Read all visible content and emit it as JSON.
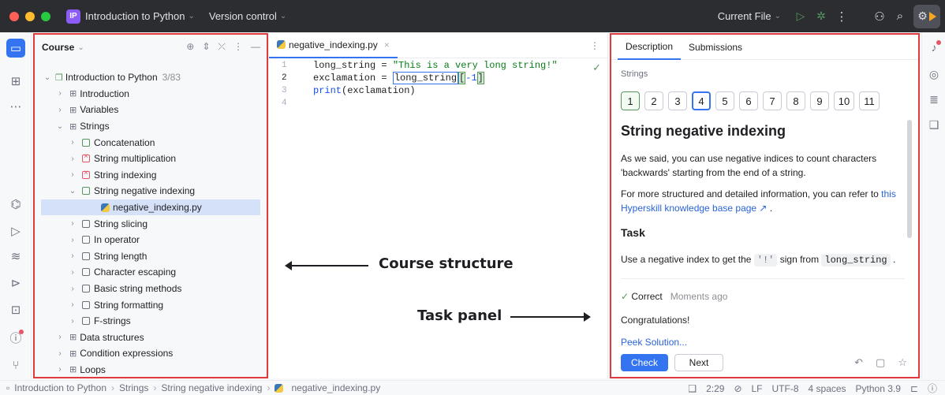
{
  "titlebar": {
    "project_badge": "IP",
    "project_name": "Introduction to Python",
    "vcs": "Version control",
    "run_config": "Current File"
  },
  "course": {
    "header": "Course",
    "root_label": "Introduction to Python",
    "root_progress": "3/83",
    "items": [
      {
        "label": "Introduction",
        "kind": "section",
        "depth": 1,
        "open": false
      },
      {
        "label": "Variables",
        "kind": "section",
        "depth": 1,
        "open": false
      },
      {
        "label": "Strings",
        "kind": "section",
        "depth": 1,
        "open": true
      },
      {
        "label": "Concatenation",
        "kind": "task-ok",
        "depth": 2,
        "open": false
      },
      {
        "label": "String multiplication",
        "kind": "task-err",
        "depth": 2,
        "open": false
      },
      {
        "label": "String indexing",
        "kind": "task-err",
        "depth": 2,
        "open": false
      },
      {
        "label": "String negative indexing",
        "kind": "task-ok",
        "depth": 2,
        "open": true
      },
      {
        "label": "negative_indexing.py",
        "kind": "file",
        "depth": 3,
        "open": false
      },
      {
        "label": "String slicing",
        "kind": "task",
        "depth": 2,
        "open": false
      },
      {
        "label": "In operator",
        "kind": "task",
        "depth": 2,
        "open": false
      },
      {
        "label": "String length",
        "kind": "task",
        "depth": 2,
        "open": false
      },
      {
        "label": "Character escaping",
        "kind": "task",
        "depth": 2,
        "open": false
      },
      {
        "label": "Basic string methods",
        "kind": "task",
        "depth": 2,
        "open": false
      },
      {
        "label": "String formatting",
        "kind": "task",
        "depth": 2,
        "open": false
      },
      {
        "label": "F-strings",
        "kind": "task",
        "depth": 2,
        "open": false
      },
      {
        "label": "Data structures",
        "kind": "section",
        "depth": 1,
        "open": false
      },
      {
        "label": "Condition expressions",
        "kind": "section",
        "depth": 1,
        "open": false
      },
      {
        "label": "Loops",
        "kind": "section",
        "depth": 1,
        "open": false
      }
    ]
  },
  "editor": {
    "tab_name": "negative_indexing.py",
    "line_numbers": [
      "1",
      "2",
      "3",
      "4"
    ],
    "line1_var": "long_string = ",
    "line1_str": "\"This is a very long string!\"",
    "line2_var": "exclamation = ",
    "line2_sel": "long_string",
    "line2_open": "[",
    "line2_idx": "-1",
    "line2_close": "]",
    "line3_fn": "print",
    "line3_arg": "(exclamation)"
  },
  "task": {
    "tab_description": "Description",
    "tab_submissions": "Submissions",
    "section": "Strings",
    "steps": [
      "1",
      "2",
      "3",
      "4",
      "5",
      "6",
      "7",
      "8",
      "9",
      "10",
      "11"
    ],
    "current_step": 4,
    "title": "String negative indexing",
    "para1": "As we said, you can use negative indices to count characters 'backwards' starting from the end of a string.",
    "para2_pre": "For more structured and detailed information, you can refer to ",
    "para2_link": "this Hyperskill knowledge base page ↗",
    "para2_post": " .",
    "task_heading": "Task",
    "task_pre": "Use a negative index to get the ",
    "task_code1": "'!'",
    "task_mid": " sign from ",
    "task_code2": "long_string",
    "task_post": " .",
    "status": "Correct",
    "status_time": "Moments ago",
    "congrats": "Congratulations!",
    "peek": "Peek Solution...",
    "check_label": "Check",
    "next_label": "Next"
  },
  "statusbar": {
    "crumbs": [
      "Introduction to Python",
      "Strings",
      "String negative indexing",
      "negative_indexing.py"
    ],
    "position": "2:29",
    "line_ending": "LF",
    "encoding": "UTF-8",
    "indent": "4 spaces",
    "interpreter": "Python 3.9"
  },
  "annotations": {
    "course_label": "Course structure",
    "task_label": "Task panel"
  },
  "colors": {
    "accent": "#3574f0",
    "highlight_border": "#e0393e",
    "success": "#57965c",
    "error": "#e55765"
  }
}
